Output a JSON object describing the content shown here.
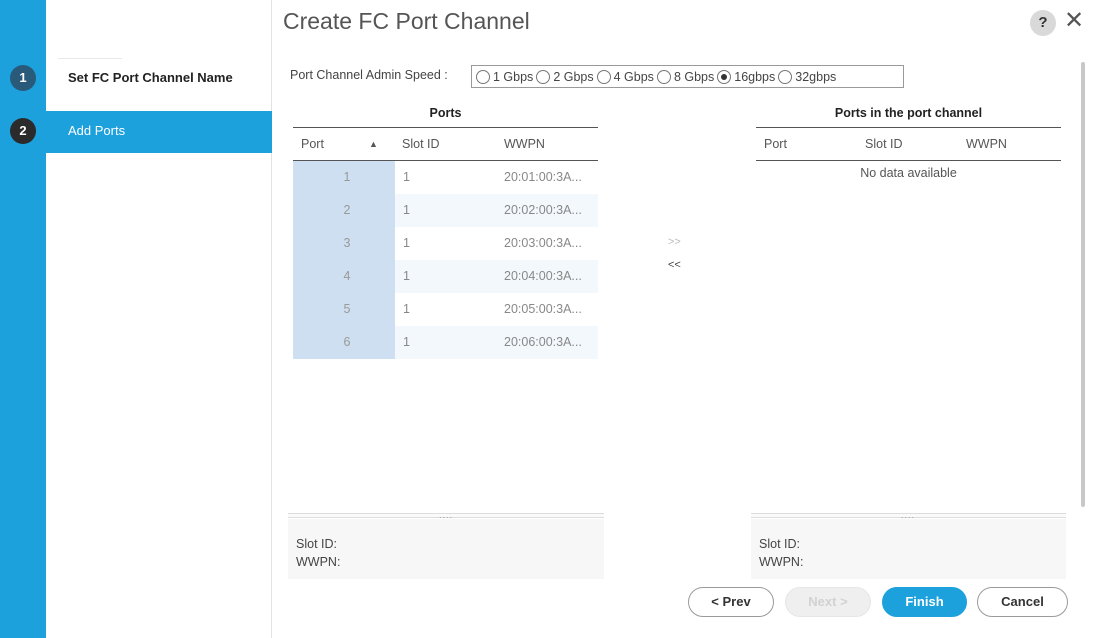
{
  "dialog": {
    "title": "Create FC Port Channel",
    "help_label": "?",
    "close_label": "✕"
  },
  "steps": [
    {
      "number": "1",
      "label": "Set FC Port Channel Name"
    },
    {
      "number": "2",
      "label": "Add Ports"
    }
  ],
  "speed": {
    "label": "Port Channel Admin Speed :",
    "options": [
      "1 Gbps",
      "2 Gbps",
      "4 Gbps",
      "8 Gbps",
      "16gbps",
      "32gbps"
    ],
    "selected": "16gbps"
  },
  "ports_table": {
    "title": "Ports",
    "columns": [
      "Port",
      "Slot ID",
      "WWPN"
    ],
    "sort_indicator": "▲",
    "rows": [
      {
        "port": "1",
        "slot": "1",
        "wwpn": "20:01:00:3A..."
      },
      {
        "port": "2",
        "slot": "1",
        "wwpn": "20:02:00:3A..."
      },
      {
        "port": "3",
        "slot": "1",
        "wwpn": "20:03:00:3A..."
      },
      {
        "port": "4",
        "slot": "1",
        "wwpn": "20:04:00:3A..."
      },
      {
        "port": "5",
        "slot": "1",
        "wwpn": "20:05:00:3A..."
      },
      {
        "port": "6",
        "slot": "1",
        "wwpn": "20:06:00:3A..."
      }
    ]
  },
  "channel_table": {
    "title": "Ports in the port channel",
    "columns": [
      "Port",
      "Slot ID",
      "WWPN"
    ],
    "empty_text": "No data available"
  },
  "transfer": {
    "add_label": ">>",
    "remove_label": "<<"
  },
  "details_left": {
    "slot_label": "Slot ID:",
    "wwpn_label": "WWPN:"
  },
  "details_right": {
    "slot_label": "Slot ID:",
    "wwpn_label": "WWPN:"
  },
  "grip": "....",
  "buttons": {
    "prev": "< Prev",
    "next": "Next >",
    "finish": "Finish",
    "cancel": "Cancel"
  },
  "colors": {
    "accent": "#1da1dc",
    "selected_column": "#cddff0"
  }
}
